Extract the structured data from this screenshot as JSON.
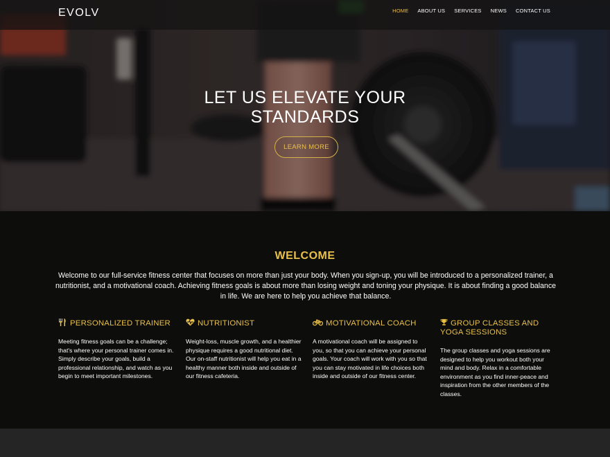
{
  "brand": {
    "logo": "EVOLV"
  },
  "nav": {
    "items": [
      {
        "label": "HOME",
        "active": true
      },
      {
        "label": "ABOUT US",
        "active": false
      },
      {
        "label": "SERVICES",
        "active": false
      },
      {
        "label": "NEWS",
        "active": false
      },
      {
        "label": "CONTACT US",
        "active": false
      }
    ]
  },
  "hero": {
    "title_line1": "LET US ELEVATE YOUR",
    "title_line2": "STANDARDS",
    "button_label": "LEARN MORE"
  },
  "welcome": {
    "title": "WELCOME",
    "text": "Welcome to our full-service fitness center that focuses on more than just your body. When you sign-up, you will be introduced to a personalized trainer, a nutritionist, and a motivational coach. Achieving fitness goals is about more than losing weight and toning your physique. It is about finding a good balance in life. We are here to help you achieve that balance."
  },
  "features": [
    {
      "icon": "utensils-icon",
      "title": "PERSONALIZED TRAINER",
      "text": "Meeting fitness goals can be a challenge; that's where your personal trainer comes in. Simply describe your goals, build a professional relationship, and watch as you begin to meet important milestones."
    },
    {
      "icon": "heartbeat-icon",
      "title": "NUTRITIONIST",
      "text": "Weight-loss, muscle growth, and a healthier physique requires a good nutritional diet. Our on-staff nutritionist will help you eat in a healthy manner both inside and outside of our fitness cafeteria."
    },
    {
      "icon": "bicycle-icon",
      "title": "MOTIVATIONAL COACH",
      "text": "A motivational coach will be assigned to you, so that you can achieve your personal goals. Your coach will work with you so that you can stay motivated in life choices both inside and outside of our fitness center."
    },
    {
      "icon": "trophy-icon",
      "title": "GROUP CLASSES AND YOGA SESSIONS",
      "text": "The group classes and yoga sessions are designed to help you workout both your mind and body. Relax in a comfortable environment as you find inner-peace and inspiration from the other members of the classes."
    }
  ],
  "colors": {
    "accent": "#e8c04a",
    "background": "#0d0d0b",
    "footer": "#252525"
  }
}
